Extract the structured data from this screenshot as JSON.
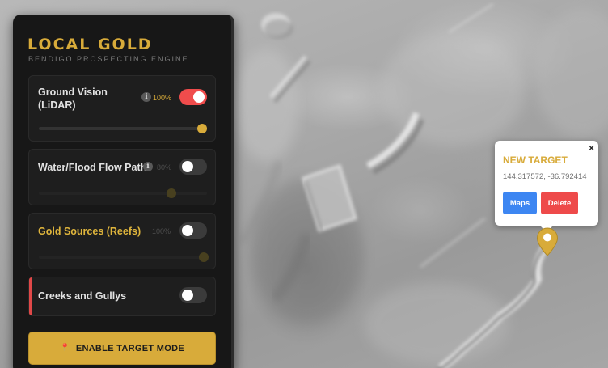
{
  "app": {
    "title": "LOCAL GOLD",
    "subtitle": "BENDIGO PROSPECTING ENGINE",
    "accent_color": "#d8ab3a"
  },
  "layers": [
    {
      "label": "Ground Vision (LiDAR)",
      "opacity_label": "100%",
      "opacity": 1.0,
      "enabled": true,
      "has_info": true,
      "info_icon": "info-icon"
    },
    {
      "label": "Water/Flood Flow Path",
      "opacity_label": "80%",
      "opacity": 0.8,
      "enabled": false,
      "has_info": true,
      "info_icon": "info-icon"
    },
    {
      "label": "Gold Sources (Reefs)",
      "opacity_label": "100%",
      "opacity": 1.0,
      "enabled": false,
      "has_info": false
    },
    {
      "label": "Creeks and Gullys",
      "enabled": false
    }
  ],
  "target_button": {
    "label": "ENABLE TARGET MODE",
    "icon": "pushpin-icon"
  },
  "popup": {
    "title": "NEW TARGET",
    "coords": "144.317572, -36.792414",
    "close_label": "×",
    "maps_label": "Maps",
    "delete_label": "Delete",
    "maps_color": "#3d86f2",
    "delete_color": "#ee4a4a"
  },
  "marker": {
    "icon": "map-pin-icon",
    "color": "#d8ab3a"
  },
  "colors": {
    "toggle_on": "#f04c4c",
    "panel_bg": "#171717"
  }
}
